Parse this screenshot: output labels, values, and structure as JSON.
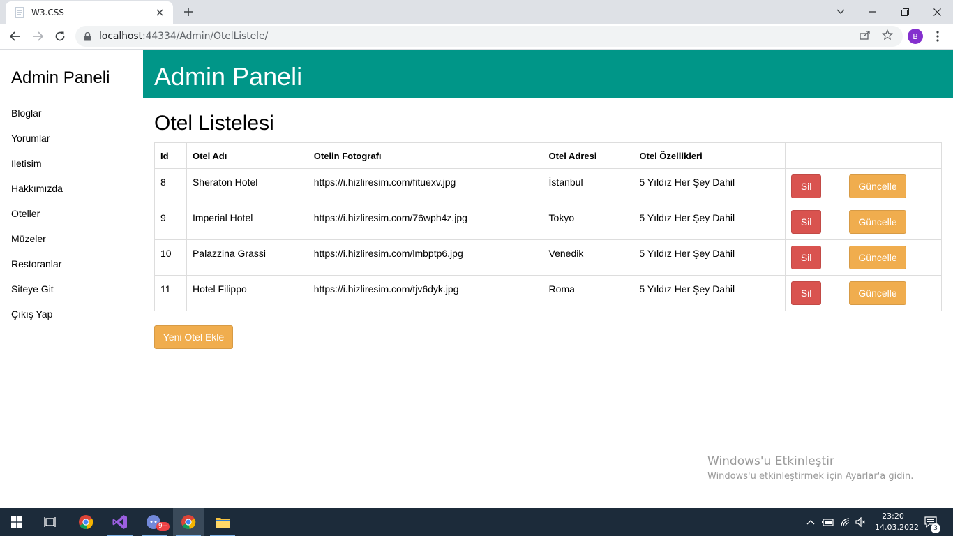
{
  "browser": {
    "tab_title": "W3.CSS",
    "url_host": "localhost",
    "url_path": ":44334/Admin/OtelListele/",
    "profile_initial": "B"
  },
  "sidebar": {
    "title": "Admin Paneli",
    "items": [
      {
        "label": "Bloglar"
      },
      {
        "label": "Yorumlar"
      },
      {
        "label": "Iletisim"
      },
      {
        "label": "Hakkımızda"
      },
      {
        "label": "Oteller"
      },
      {
        "label": "Müzeler"
      },
      {
        "label": "Restoranlar"
      },
      {
        "label": "Siteye Git"
      },
      {
        "label": "Çıkış Yap"
      }
    ]
  },
  "header": {
    "title": "Admin Paneli",
    "color": "#009688"
  },
  "main": {
    "title": "Otel Listelesi",
    "columns": [
      "Id",
      "Otel Adı",
      "Otelin Fotografı",
      "Otel Adresi",
      "Otel Özellikleri"
    ],
    "rows": [
      {
        "id": "8",
        "name": "Sheraton Hotel",
        "photo": "https://i.hizliresim.com/fituexv.jpg",
        "address": "İstanbul",
        "features": "5 Yıldız Her Şey Dahil"
      },
      {
        "id": "9",
        "name": "Imperial Hotel",
        "photo": "https://i.hizliresim.com/76wph4z.jpg",
        "address": "Tokyo",
        "features": "5 Yıldız Her Şey Dahil"
      },
      {
        "id": "10",
        "name": "Palazzina Grassi",
        "photo": "https://i.hizliresim.com/lmbptp6.jpg",
        "address": "Venedik",
        "features": "5 Yıldız Her Şey Dahil"
      },
      {
        "id": "11",
        "name": "Hotel Filippo",
        "photo": "https://i.hizliresim.com/tjv6dyk.jpg",
        "address": "Roma",
        "features": "5 Yıldız Her Şey Dahil"
      }
    ],
    "delete_label": "Sil",
    "update_label": "Güncelle",
    "add_label": "Yeni Otel Ekle",
    "danger_color": "#d9534f",
    "warning_color": "#f0ad4e"
  },
  "watermark": {
    "line1": "Windows'u Etkinleştir",
    "line2": "Windows'u etkinleştirmek için Ayarlar'a gidin."
  },
  "taskbar": {
    "time": "23:20",
    "date": "14.03.2022",
    "notification_count": "3",
    "discord_badge": "9+"
  }
}
